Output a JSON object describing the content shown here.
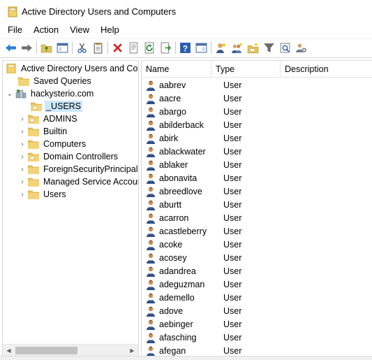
{
  "window": {
    "title": "Active Directory Users and Computers"
  },
  "menu": [
    "File",
    "Action",
    "View",
    "Help"
  ],
  "toolbar": {
    "icons": [
      "back-icon",
      "forward-icon",
      "up-folder-icon",
      "show-hide-tree-icon",
      "cut-icon",
      "copy-icon",
      "delete-icon",
      "properties-icon",
      "refresh-icon",
      "export-list-icon",
      "help-icon",
      "console-tree-icon",
      "new-user-icon",
      "new-group-icon",
      "new-ou-icon",
      "filter-icon",
      "find-icon",
      "delegate-icon"
    ]
  },
  "tree": {
    "root": "Active Directory Users and Com",
    "saved_queries": "Saved Queries",
    "domain": "hackysterio.com",
    "children": [
      "_USERS",
      "ADMINS",
      "Builtin",
      "Computers",
      "Domain Controllers",
      "ForeignSecurityPrincipals",
      "Managed Service Accoun",
      "Users"
    ],
    "selected": "_USERS"
  },
  "list": {
    "columns": [
      "Name",
      "Type",
      "Description"
    ],
    "rows": [
      {
        "name": "aabrev",
        "type": "User"
      },
      {
        "name": "aacre",
        "type": "User"
      },
      {
        "name": "abargo",
        "type": "User"
      },
      {
        "name": "abilderback",
        "type": "User"
      },
      {
        "name": "abirk",
        "type": "User"
      },
      {
        "name": "ablackwater",
        "type": "User"
      },
      {
        "name": "ablaker",
        "type": "User"
      },
      {
        "name": "abonavita",
        "type": "User"
      },
      {
        "name": "abreedlove",
        "type": "User"
      },
      {
        "name": "aburtt",
        "type": "User"
      },
      {
        "name": "acarron",
        "type": "User"
      },
      {
        "name": "acastleberry",
        "type": "User"
      },
      {
        "name": "acoke",
        "type": "User"
      },
      {
        "name": "acosey",
        "type": "User"
      },
      {
        "name": "adandrea",
        "type": "User"
      },
      {
        "name": "adeguzman",
        "type": "User"
      },
      {
        "name": "ademello",
        "type": "User"
      },
      {
        "name": "adove",
        "type": "User"
      },
      {
        "name": "aebinger",
        "type": "User"
      },
      {
        "name": "afasching",
        "type": "User"
      },
      {
        "name": "afegan",
        "type": "User"
      }
    ]
  },
  "colors": {
    "selection": "#cce8ff",
    "folder": "#e8c25b",
    "accent": "#0078d7"
  }
}
